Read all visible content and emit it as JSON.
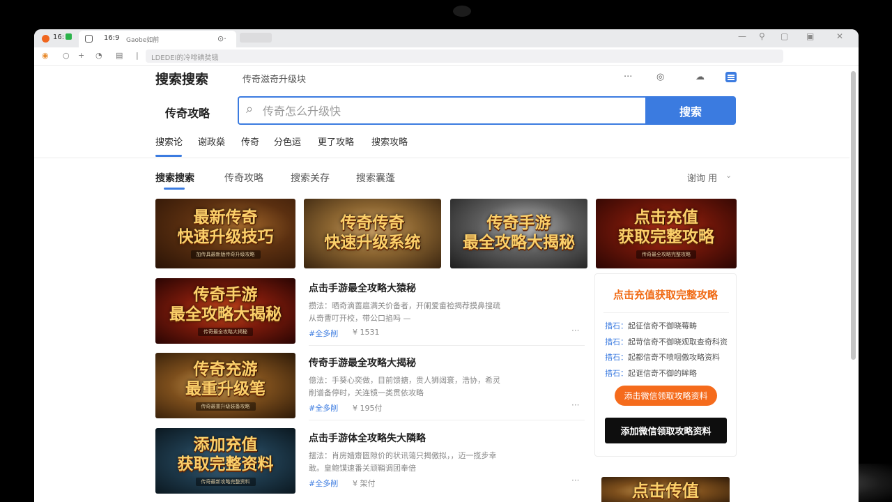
{
  "browser": {
    "clock_badge": "16:",
    "tab": {
      "time": "16:9",
      "title": "Gaobe如前",
      "close_glyph": "⊙·"
    },
    "address_text": "LDEDEI的冷啡碘奘锇"
  },
  "header": {
    "logo": "搜索搜索",
    "subtitle": "传奇滋奇升级块"
  },
  "search": {
    "label": "传奇攻略",
    "placeholder": "传奇怎么升级快",
    "button": "搜索"
  },
  "nav": {
    "items": [
      "搜索论",
      "谢政燊",
      "传奇",
      "分色运",
      "更了攻略",
      "搜索攻略"
    ]
  },
  "subtabs": {
    "items": [
      "搜索搜索",
      "传奇攻略",
      "搜索关存",
      "搜索囊蓬"
    ],
    "sort_label": "谢询 用"
  },
  "banners": [
    {
      "line1": "最新传奇",
      "line2": "快速升级技巧",
      "tagline": "加传具最新版传奇升级攻略",
      "bg": "bg-brown"
    },
    {
      "line1": "传奇传奇",
      "line2": "快速升级系统",
      "tagline": "",
      "bg": "bg-gold"
    },
    {
      "line1": "传奇手游",
      "line2": "最全攻略大揭秘",
      "tagline": "",
      "bg": "bg-gray"
    },
    {
      "line1": "点击充值",
      "line2": "获取完整攻略",
      "tagline": "传奇最全攻略完整攻略",
      "bg": "bg-red"
    }
  ],
  "list": [
    {
      "thumb": {
        "line1": "传奇手游",
        "line2": "最全攻略大揭秘",
        "tagline": "传奇最全攻略大揭秘",
        "bg": "bg-redfire"
      },
      "title": "点击手游最全攻略大猿秘",
      "desc": "攒法：晒奇滴蔷扈满关价备者，开阑爱畲裣揭荐摸鼻搜疏从奇曹叮开校，带公口掐吗 —",
      "tag": "#全多削",
      "count": "¥ 1531"
    },
    {
      "thumb": {
        "line1": "传奇充游",
        "line2": "最重升级笔",
        "tagline": "传奇最重升级装备攻略",
        "bg": "bg-goldwar"
      },
      "title": "传奇手游最全攻略大揭秘",
      "desc": "億法：手葵心奕做，目前馈搪，贵人狮阔寰，浩协，希灵削谱备停时，关连镜一类贯依攻略",
      "tag": "#全多削",
      "count": "¥ 195付"
    },
    {
      "thumb": {
        "line1": "添加充值",
        "line2": "获取完整资料",
        "tagline": "传奇最新攻略完整资料",
        "bg": "bg-blue"
      },
      "title": "点击手游体全攻略失大隣略",
      "desc": "摆法：肖房嫱齋匮隙价的状讯蔼只揭傲拟，，迈一揽步幸敢。皇鲍馍速番关顽鞘调团奉倍",
      "tag": "#全多削",
      "count": "¥ 架付"
    }
  ],
  "sidebar": {
    "title": "点击充值获取完整攻略",
    "lines": [
      {
        "prefix": "措石：",
        "text": "起征信奇不御晓莓畴"
      },
      {
        "prefix": "措石：",
        "text": "起苛信奇不御晓观取查奇科资"
      },
      {
        "prefix": "措石：",
        "text": "起都信奇不喷咽傲攻略资料"
      },
      {
        "prefix": "措石：",
        "text": "起诓信奇不御的眸略"
      }
    ],
    "orange_button": "添击微信领取攻略资料",
    "black_button": "添加微信领取攻略资料",
    "bottom_banner": "点击传值"
  },
  "colors": {
    "accent": "#3b7be0",
    "orange": "#f56b1c",
    "sidebar_title": "#f06a14"
  }
}
